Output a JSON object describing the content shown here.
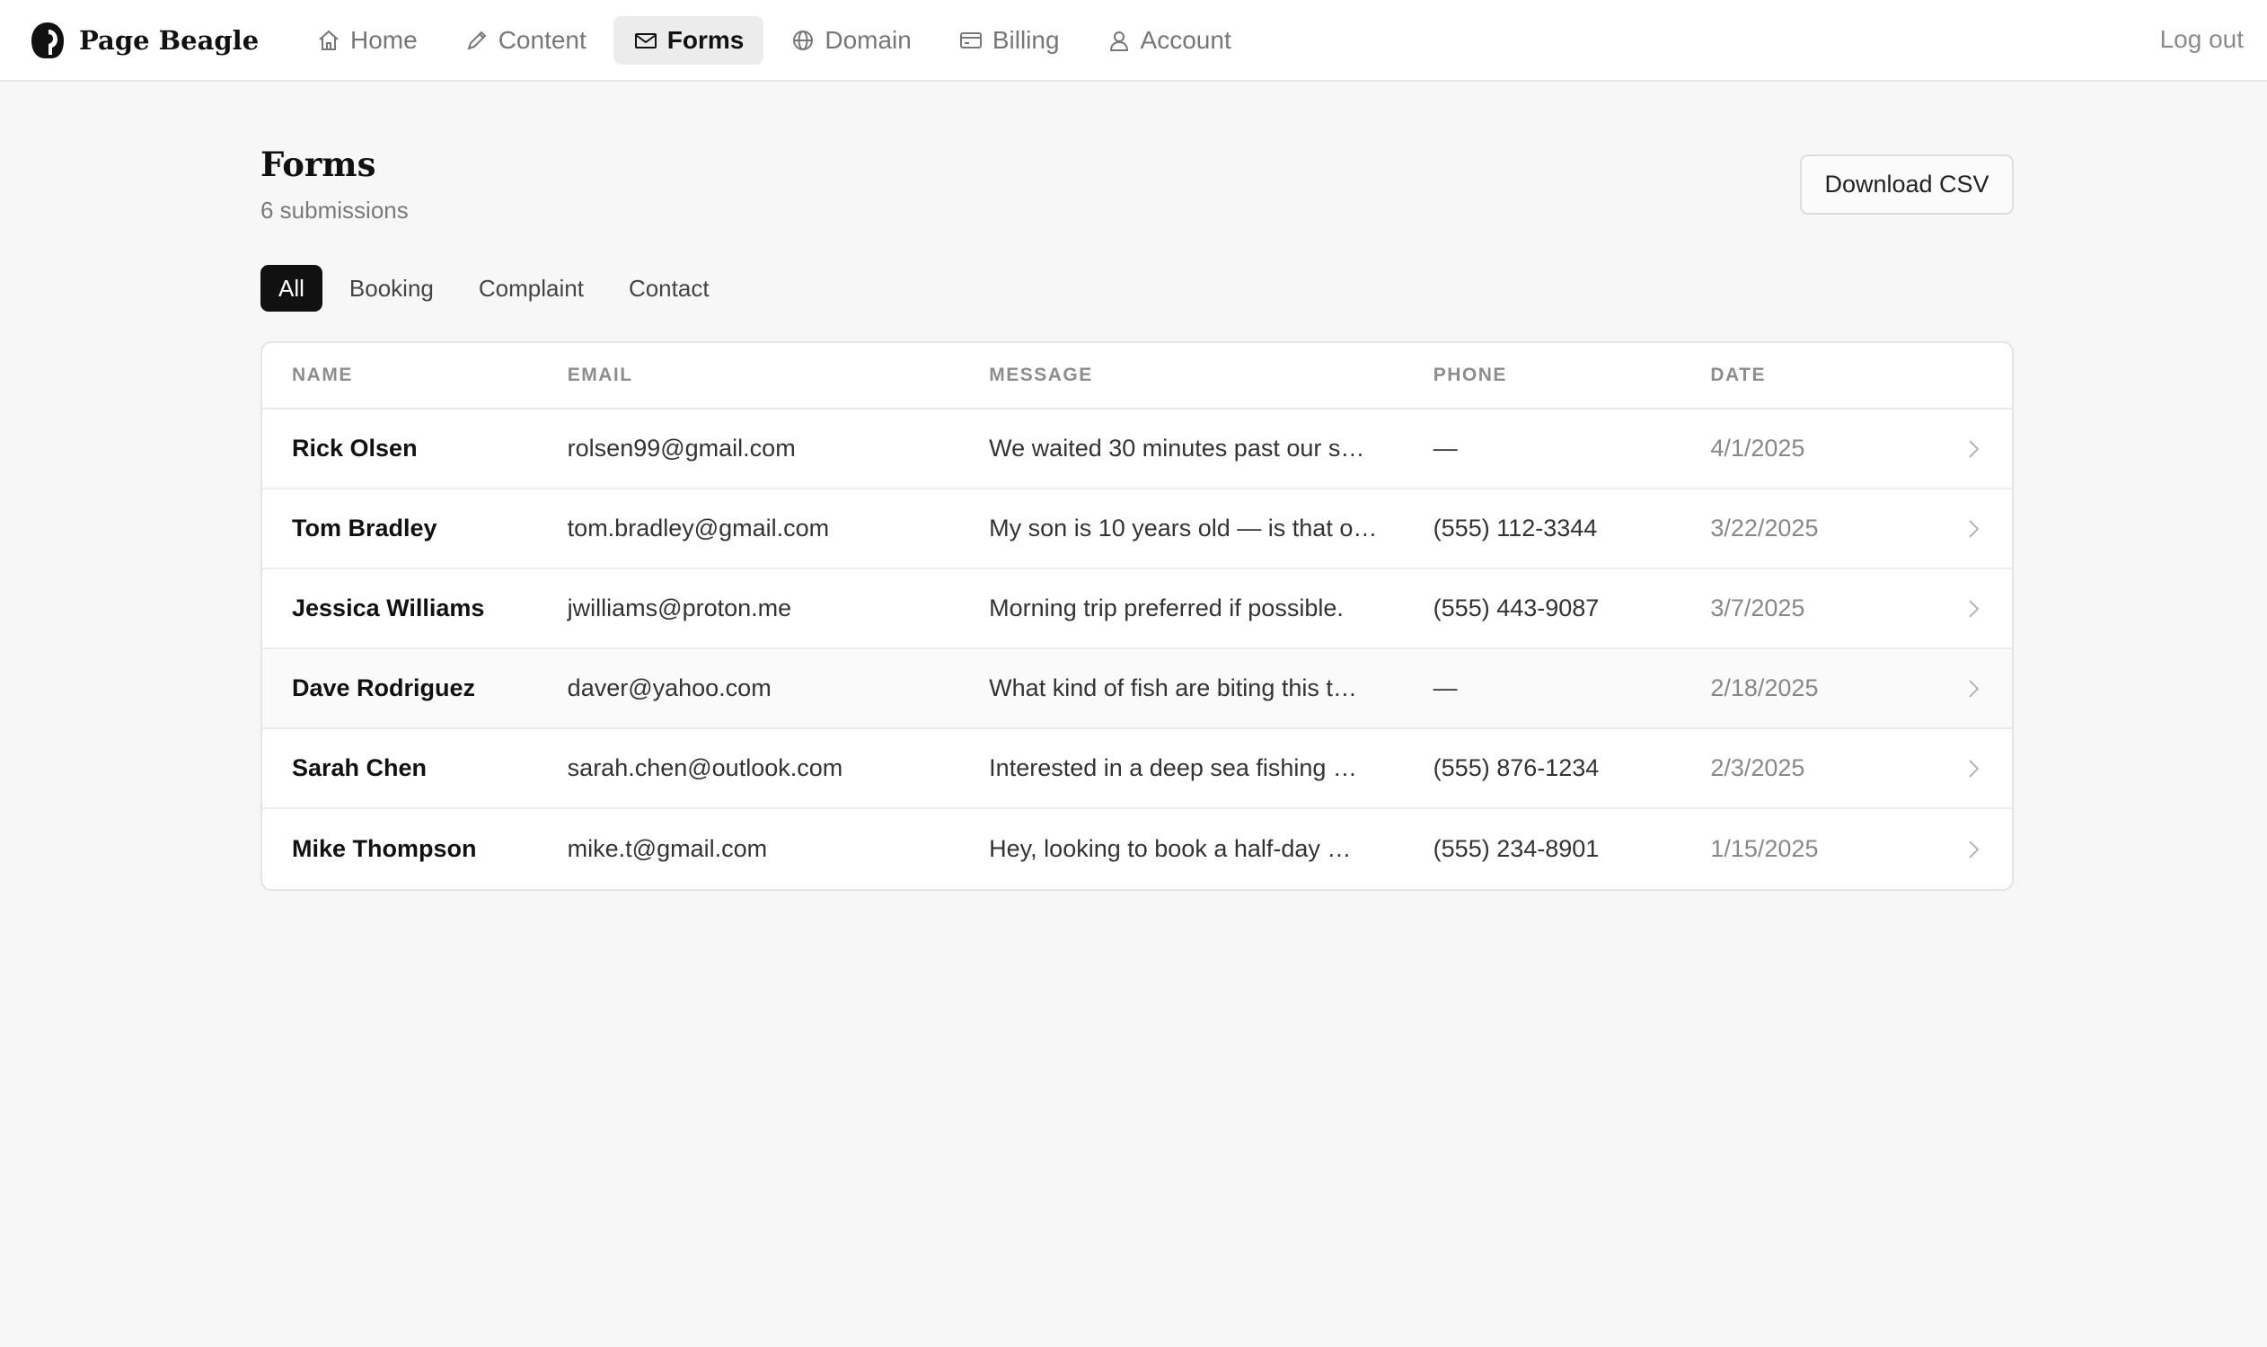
{
  "header": {
    "brand": "Page Beagle",
    "nav": [
      {
        "label": "Home",
        "icon": "house-icon"
      },
      {
        "label": "Content",
        "icon": "pencil-icon"
      },
      {
        "label": "Forms",
        "icon": "envelope-icon",
        "active": true
      },
      {
        "label": "Domain",
        "icon": "globe-icon"
      },
      {
        "label": "Billing",
        "icon": "credit-card-icon"
      },
      {
        "label": "Account",
        "icon": "user-icon"
      }
    ],
    "logout": "Log out"
  },
  "page": {
    "title": "Forms",
    "subtitle": "6 submissions",
    "download_label": "Download CSV"
  },
  "filters": {
    "tabs": [
      "All",
      "Booking",
      "Complaint",
      "Contact"
    ],
    "active": "All"
  },
  "table": {
    "columns": [
      "NAME",
      "EMAIL",
      "MESSAGE",
      "PHONE",
      "DATE"
    ],
    "rows": [
      {
        "name": "Rick Olsen",
        "email": "rolsen99@gmail.com",
        "message": "We waited 30 minutes past our s…",
        "phone": "—",
        "date": "4/1/2025"
      },
      {
        "name": "Tom Bradley",
        "email": "tom.bradley@gmail.com",
        "message": "My son is 10 years old — is that o…",
        "phone": "(555) 112-3344",
        "date": "3/22/2025"
      },
      {
        "name": "Jessica Williams",
        "email": "jwilliams@proton.me",
        "message": "Morning trip preferred if possible.",
        "phone": "(555) 443-9087",
        "date": "3/7/2025"
      },
      {
        "name": "Dave Rodriguez",
        "email": "daver@yahoo.com",
        "message": "What kind of fish are biting this t…",
        "phone": "—",
        "date": "2/18/2025"
      },
      {
        "name": "Sarah Chen",
        "email": "sarah.chen@outlook.com",
        "message": "Interested in a deep sea fishing …",
        "phone": "(555) 876-1234",
        "date": "2/3/2025"
      },
      {
        "name": "Mike Thompson",
        "email": "mike.t@gmail.com",
        "message": "Hey, looking to book a half-day …",
        "phone": "(555) 234-8901",
        "date": "1/15/2025"
      }
    ]
  }
}
